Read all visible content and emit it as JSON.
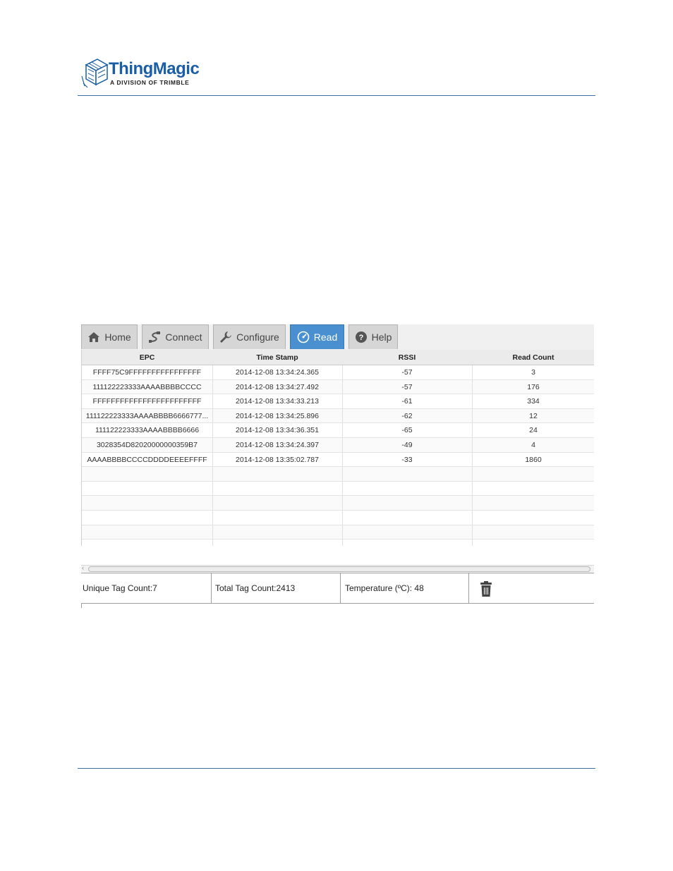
{
  "brand": {
    "name": "ThingMagic",
    "tagline": "A DIVISION OF TRIMBLE",
    "color": "#1a5ea5"
  },
  "tabs": [
    {
      "label": "Home",
      "icon": "home-icon",
      "active": false
    },
    {
      "label": "Connect",
      "icon": "connect-icon",
      "active": false
    },
    {
      "label": "Configure",
      "icon": "wrench-icon",
      "active": false
    },
    {
      "label": "Read",
      "icon": "gauge-icon",
      "active": true
    },
    {
      "label": "Help",
      "icon": "help-icon",
      "active": false
    }
  ],
  "accent_color": "#4a90d0",
  "table": {
    "columns": [
      "EPC",
      "Time Stamp",
      "RSSI",
      "Read Count"
    ],
    "rows": [
      [
        "FFFF75C9FFFFFFFFFFFFFFFF",
        "2014-12-08 13:34:24.365",
        "-57",
        "3"
      ],
      [
        "111122223333AAAABBBBCCCC",
        "2014-12-08 13:34:27.492",
        "-57",
        "176"
      ],
      [
        "FFFFFFFFFFFFFFFFFFFFFFFF",
        "2014-12-08 13:34:33.213",
        "-61",
        "334"
      ],
      [
        "111122223333AAAABBBB6666777...",
        "2014-12-08 13:34:25.896",
        "-62",
        "12"
      ],
      [
        "111122223333AAAABBBB6666",
        "2014-12-08 13:34:36.351",
        "-65",
        "24"
      ],
      [
        "3028354D82020000000359B7",
        "2014-12-08 13:34:24.397",
        "-49",
        "4"
      ],
      [
        "AAAABBBBCCCCDDDDEEEEFFFF",
        "2014-12-08 13:35:02.787",
        "-33",
        "1860"
      ]
    ],
    "empty_rows": 7
  },
  "status": {
    "unique_tag_count": "Unique Tag Count:7",
    "total_tag_count": "Total Tag Count:2413",
    "temperature": "Temperature (ºC):  48",
    "clear_icon": "trash-icon"
  }
}
